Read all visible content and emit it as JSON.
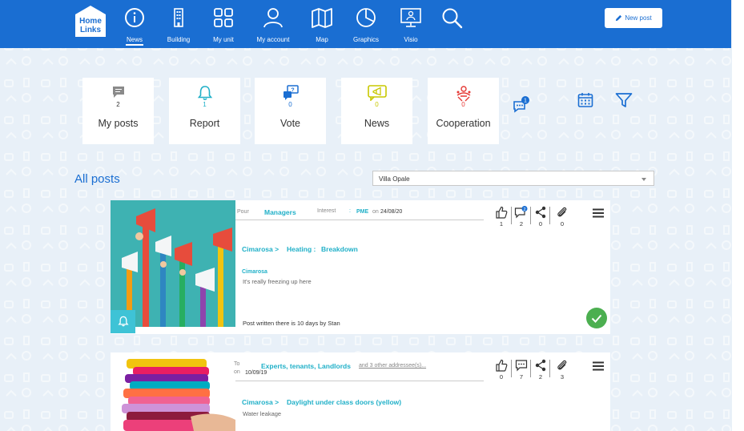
{
  "app": {
    "logo_line1": "Home",
    "logo_line2": "Links"
  },
  "nav": [
    {
      "label": "News",
      "icon": "info-icon",
      "active": true
    },
    {
      "label": "Building",
      "icon": "building-icon"
    },
    {
      "label": "My unit",
      "icon": "grid-icon"
    },
    {
      "label": "My account",
      "icon": "user-icon"
    },
    {
      "label": "Map",
      "icon": "map-icon"
    },
    {
      "label": "Graphics",
      "icon": "pie-chart-icon"
    },
    {
      "label": "Visio",
      "icon": "monitor-icon"
    }
  ],
  "search": {
    "icon": "search-icon"
  },
  "new_post": {
    "label": "New post",
    "icon": "pencil-icon"
  },
  "categories": [
    {
      "label": "My posts",
      "count": "2",
      "icon": "message-icon",
      "color": "#888888"
    },
    {
      "label": "Report",
      "count": "1",
      "icon": "bell-icon",
      "color": "#20b0c8"
    },
    {
      "label": "Vote",
      "count": "0",
      "icon": "vote-icon",
      "color": "#1a6ed2"
    },
    {
      "label": "News",
      "count": "0",
      "icon": "megaphone-icon",
      "color": "#c8c800"
    },
    {
      "label": "Cooperation",
      "count": "0",
      "icon": "cooperation-icon",
      "color": "#e53935"
    }
  ],
  "toolbar": {
    "chat_badge": "1"
  },
  "section_title": "All posts",
  "residence_select": {
    "value": "Villa Opale"
  },
  "posts": [
    {
      "for_label": "Pour",
      "for_value": "Managers",
      "interest_label": "Interest",
      "interest_sep": ":",
      "interest_value": "PME",
      "on_label": "on",
      "date": "24/08/20",
      "path_1": "Cimarosa >",
      "path_2": "Heating :",
      "path_3": "Breakdown",
      "author": "Cimarosa",
      "body": "It's really freezing up here",
      "footer": "Post written there is 10 days by Stan",
      "likes": "1",
      "comments": "2",
      "comments_badge": "2",
      "shares": "0",
      "attachments": "0",
      "status": "resolved"
    },
    {
      "to_label": "To",
      "on_label": "on",
      "date": "10/09/19",
      "recipients": "Experts, tenants, Landlords",
      "more_recipients": "and 3 other addressee(s)...",
      "path_1": "Cimarosa >",
      "path_2": "Daylight under class doors (yellow)",
      "body": "Water leakage",
      "likes": "0",
      "comments": "7",
      "shares": "2",
      "attachments": "3"
    }
  ]
}
